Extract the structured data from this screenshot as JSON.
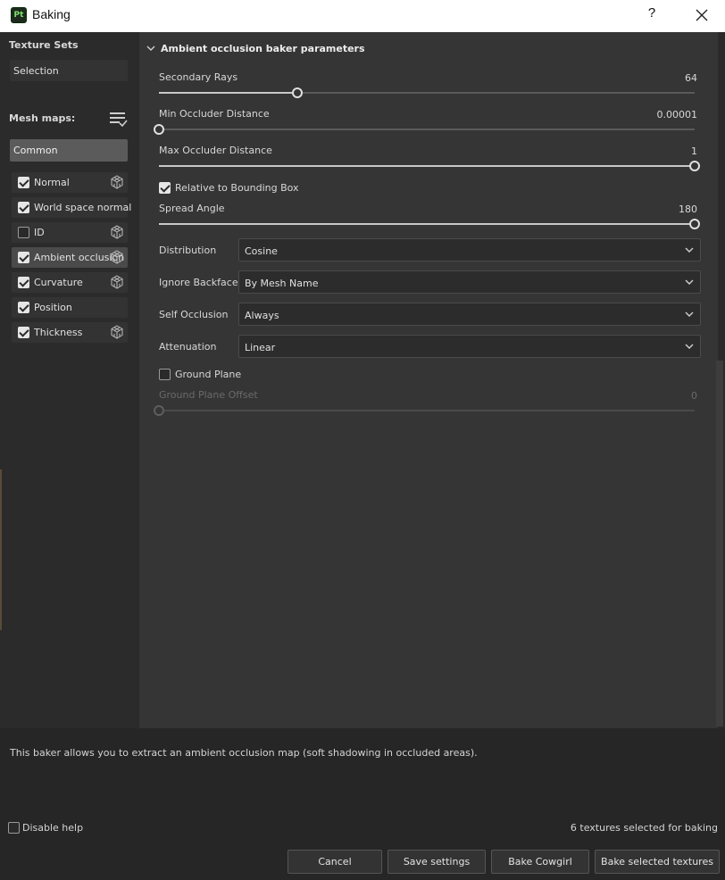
{
  "window": {
    "app_icon_text": "Pt",
    "title": "Baking",
    "help_label": "?"
  },
  "sidebar": {
    "texture_sets_label": "Texture Sets",
    "texture_set_value": "Selection",
    "mesh_maps_label": "Mesh maps:",
    "common_label": "Common",
    "maps": [
      {
        "label": "Normal",
        "checked": true,
        "has_icon": true,
        "active": false
      },
      {
        "label": "World space normal",
        "checked": true,
        "has_icon": false,
        "active": false
      },
      {
        "label": "ID",
        "checked": false,
        "has_icon": true,
        "active": false
      },
      {
        "label": "Ambient occlusion",
        "checked": true,
        "has_icon": true,
        "active": true
      },
      {
        "label": "Curvature",
        "checked": true,
        "has_icon": true,
        "active": false
      },
      {
        "label": "Position",
        "checked": true,
        "has_icon": false,
        "active": false
      },
      {
        "label": "Thickness",
        "checked": true,
        "has_icon": true,
        "active": false
      }
    ]
  },
  "params": {
    "header": "Ambient occlusion baker parameters",
    "secondary_rays": {
      "label": "Secondary Rays",
      "value": "64",
      "fraction": 0.258
    },
    "min_occluder": {
      "label": "Min Occluder Distance",
      "value": "0.00001",
      "fraction": 0.0
    },
    "max_occluder": {
      "label": "Max Occluder Distance",
      "value": "1",
      "fraction": 1.0
    },
    "relative_bbox": {
      "label": "Relative to Bounding Box",
      "checked": true
    },
    "spread_angle": {
      "label": "Spread Angle",
      "value": "180",
      "fraction": 1.0
    },
    "distribution": {
      "label": "Distribution",
      "value": "Cosine"
    },
    "ignore_backface": {
      "label": "Ignore Backface",
      "value": "By Mesh Name"
    },
    "self_occlusion": {
      "label": "Self Occlusion",
      "value": "Always"
    },
    "attenuation": {
      "label": "Attenuation",
      "value": "Linear"
    },
    "ground_plane": {
      "label": "Ground Plane",
      "checked": false
    },
    "ground_offset": {
      "label": "Ground Plane Offset",
      "value": "0",
      "fraction": 0.0
    }
  },
  "help": {
    "text": "This baker allows you to extract an ambient occlusion map (soft shadowing in occluded areas).",
    "disable_label": "Disable help",
    "status": "6 textures selected for baking"
  },
  "buttons": {
    "cancel": "Cancel",
    "save": "Save settings",
    "bake_set": "Bake Cowgirl",
    "bake_selected": "Bake selected textures"
  }
}
